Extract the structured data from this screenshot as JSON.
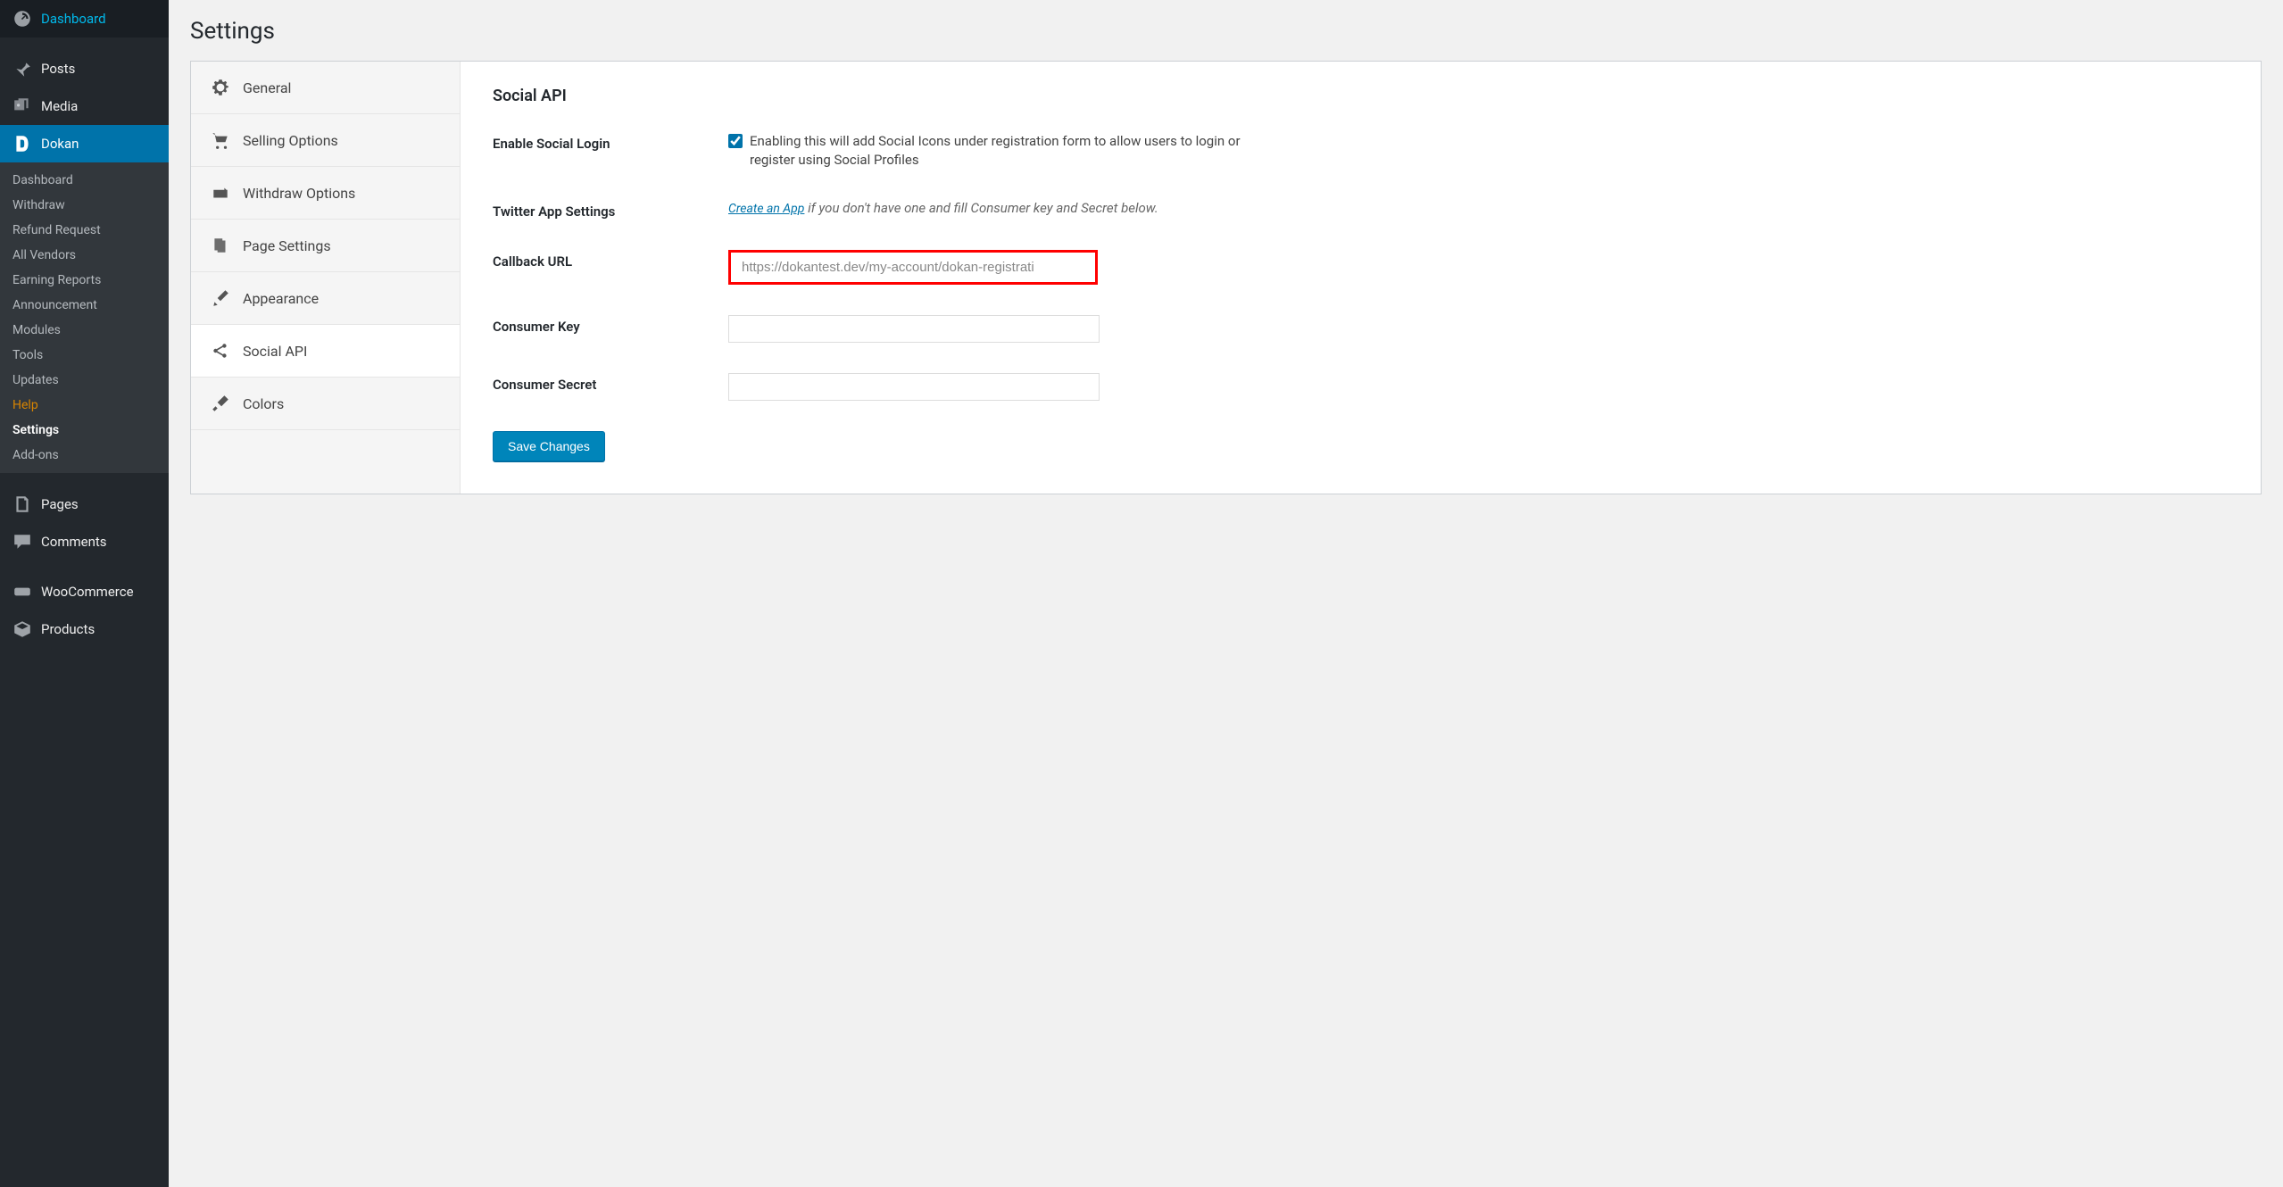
{
  "sidebar": {
    "dashboard": "Dashboard",
    "posts": "Posts",
    "media": "Media",
    "dokan": "Dokan",
    "pages": "Pages",
    "comments": "Comments",
    "woocommerce": "WooCommerce",
    "products": "Products"
  },
  "submenu": {
    "dashboard": "Dashboard",
    "withdraw": "Withdraw",
    "refund": "Refund Request",
    "vendors": "All Vendors",
    "earning": "Earning Reports",
    "announcement": "Announcement",
    "modules": "Modules",
    "tools": "Tools",
    "updates": "Updates",
    "help": "Help",
    "settings": "Settings",
    "addons": "Add-ons"
  },
  "page": {
    "title": "Settings"
  },
  "tabs": {
    "general": "General",
    "selling": "Selling Options",
    "withdraw": "Withdraw Options",
    "page": "Page Settings",
    "appearance": "Appearance",
    "social": "Social API",
    "colors": "Colors"
  },
  "panel": {
    "title": "Social API",
    "enable_label": "Enable Social Login",
    "enable_desc": "Enabling this will add Social Icons under registration form to allow users to login or register using Social Profiles",
    "enable_checked": true,
    "twitter_label": "Twitter App Settings",
    "twitter_link": "Create an App",
    "twitter_rest": " if you don't have one and fill Consumer key and Secret below.",
    "callback_label": "Callback URL",
    "callback_placeholder": "https://dokantest.dev/my-account/dokan-registrati",
    "consumer_key_label": "Consumer Key",
    "consumer_secret_label": "Consumer Secret",
    "save": "Save Changes"
  }
}
